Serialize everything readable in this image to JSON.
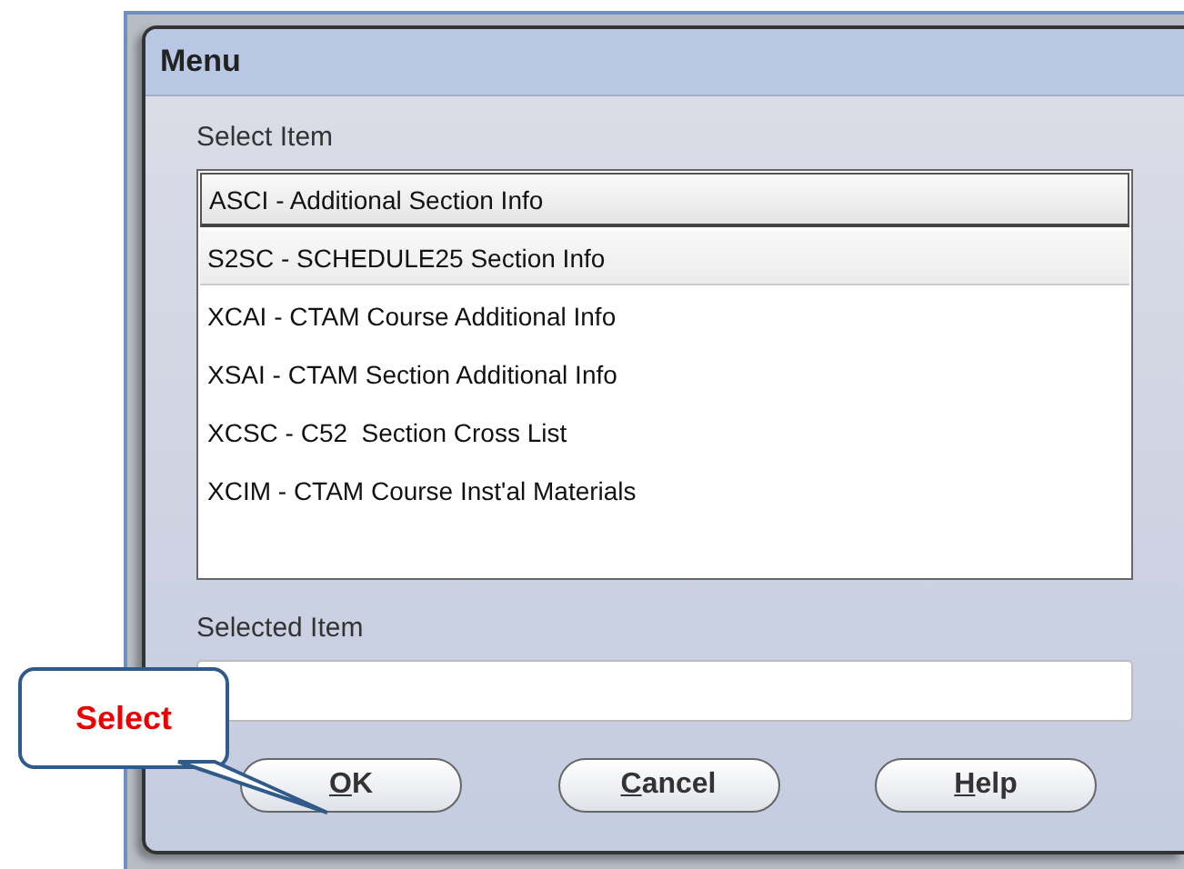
{
  "dialog": {
    "title": "Menu"
  },
  "list_label": "Select Item",
  "items": [
    {
      "label": "ASCI - Additional Section Info",
      "selected": true,
      "highlighted": false
    },
    {
      "label": "S2SC - SCHEDULE25 Section Info",
      "selected": false,
      "highlighted": true
    },
    {
      "label": "XCAI - CTAM Course Additional Info",
      "selected": false,
      "highlighted": false
    },
    {
      "label": "XSAI - CTAM Section Additional Info",
      "selected": false,
      "highlighted": false
    },
    {
      "label": "XCSC - C52  Section Cross List",
      "selected": false,
      "highlighted": false
    },
    {
      "label": "XCIM - CTAM Course Inst'al Materials",
      "selected": false,
      "highlighted": false
    }
  ],
  "field_label": "Selected Item",
  "buttons": [
    {
      "mnemonic": "O",
      "rest": "K"
    },
    {
      "mnemonic": "C",
      "rest": "ancel"
    },
    {
      "mnemonic": "H",
      "rest": "elp"
    }
  ],
  "callout": {
    "text": "Select"
  }
}
